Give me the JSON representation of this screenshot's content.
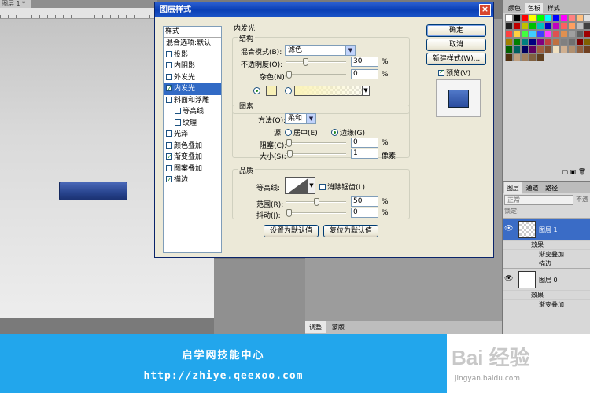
{
  "workspace": {
    "doc_tab": "图层 1 * ×",
    "adjust_tabs": [
      "调整",
      "蒙版"
    ]
  },
  "swatches_panel": {
    "tabs": [
      "颜色",
      "色板",
      "样式"
    ],
    "colors": [
      "#ffffff",
      "#000000",
      "#ff0000",
      "#ffff00",
      "#00ff00",
      "#00ffff",
      "#0000ff",
      "#ff00ff",
      "#ff8080",
      "#ffc080",
      "#e0e0e0",
      "#202020",
      "#c00000",
      "#c0c000",
      "#00c000",
      "#00c0c0",
      "#0000c0",
      "#c000c0",
      "#ff6060",
      "#ffa060",
      "#c0c0c0",
      "#404040",
      "#ff4040",
      "#ffd040",
      "#40ff40",
      "#40d0ff",
      "#4040ff",
      "#ff40ff",
      "#e05050",
      "#e09050",
      "#a0a0a0",
      "#606060",
      "#a00000",
      "#a08000",
      "#008000",
      "#008080",
      "#000080",
      "#800080",
      "#c04040",
      "#c07040",
      "#808080",
      "#707070",
      "#800000",
      "#806000",
      "#006000",
      "#006060",
      "#000060",
      "#600060",
      "#a06040",
      "#805030",
      "#f0e0c0",
      "#d0b090",
      "#b09070",
      "#906040",
      "#704020",
      "#503010",
      "#c0a080",
      "#a08060",
      "#806040",
      "#604020"
    ],
    "tools_label": "▢ ▣ 🗑"
  },
  "layers_panel": {
    "tabs": [
      "图层",
      "通道",
      "路径"
    ],
    "blend_mode": "正常",
    "opacity_label": "不透",
    "lock_label": "锁定:",
    "layers": [
      {
        "name": "图层 1",
        "effects_label": "效果",
        "effects": [
          "渐变叠加",
          "描边"
        ],
        "selected": true
      },
      {
        "name": "图层 0",
        "effects_label": "效果",
        "effects": [
          "渐变叠加"
        ],
        "selected": false
      }
    ]
  },
  "dialog": {
    "title": "图层样式",
    "close": "×",
    "style_list": {
      "header": "样式",
      "items": [
        {
          "label": "混合选项:默认",
          "checkbox": false,
          "checked": false,
          "indent": false,
          "selected": false
        },
        {
          "label": "投影",
          "checkbox": true,
          "checked": false,
          "indent": false,
          "selected": false
        },
        {
          "label": "内阴影",
          "checkbox": true,
          "checked": false,
          "indent": false,
          "selected": false
        },
        {
          "label": "外发光",
          "checkbox": true,
          "checked": false,
          "indent": false,
          "selected": false
        },
        {
          "label": "内发光",
          "checkbox": true,
          "checked": true,
          "indent": false,
          "selected": true
        },
        {
          "label": "斜面和浮雕",
          "checkbox": true,
          "checked": false,
          "indent": false,
          "selected": false
        },
        {
          "label": "等高线",
          "checkbox": true,
          "checked": false,
          "indent": true,
          "selected": false
        },
        {
          "label": "纹理",
          "checkbox": true,
          "checked": false,
          "indent": true,
          "selected": false
        },
        {
          "label": "光泽",
          "checkbox": true,
          "checked": false,
          "indent": false,
          "selected": false
        },
        {
          "label": "颜色叠加",
          "checkbox": true,
          "checked": false,
          "indent": false,
          "selected": false
        },
        {
          "label": "渐变叠加",
          "checkbox": true,
          "checked": true,
          "indent": false,
          "selected": false
        },
        {
          "label": "图案叠加",
          "checkbox": true,
          "checked": false,
          "indent": false,
          "selected": false
        },
        {
          "label": "描边",
          "checkbox": true,
          "checked": true,
          "indent": false,
          "selected": false
        }
      ]
    },
    "section_title": "内发光",
    "structure": {
      "title": "结构",
      "blend_label": "混合模式(B):",
      "blend_value": "滤色",
      "opacity_label": "不透明度(O):",
      "opacity_value": "30",
      "opacity_fraction": 0.3,
      "noise_label": "杂色(N):",
      "noise_value": "0",
      "noise_fraction": 0,
      "unit": "%",
      "glow_color": "#f8f0b6"
    },
    "elements": {
      "title": "图素",
      "method_label": "方法(Q):",
      "method_value": "柔和",
      "source_label": "源:",
      "source_center": "居中(E)",
      "source_edge": "边缘(G)",
      "choke_label": "阻塞(C):",
      "choke_value": "0",
      "choke_fraction": 0,
      "size_label": "大小(S):",
      "size_value": "1",
      "size_fraction": 0.01,
      "percent_unit": "%",
      "pixel_unit": "像素"
    },
    "quality": {
      "title": "品质",
      "contour_label": "等高线:",
      "antialias_label": "消除锯齿(L)",
      "range_label": "范围(R):",
      "range_value": "50",
      "range_fraction": 0.5,
      "jitter_label": "抖动(J):",
      "jitter_value": "0",
      "jitter_fraction": 0,
      "unit": "%"
    },
    "buttons": {
      "make_default": "设置为默认值",
      "reset_default": "复位为默认值",
      "ok": "确定",
      "cancel": "取消",
      "new_style": "新建样式(W)...",
      "preview": "预览(V)"
    }
  },
  "banner": {
    "line1": "启学网技能中心",
    "line2": "http://zhiye.qeexoo.com"
  },
  "watermark": {
    "logo": "Bai 经验",
    "sub": "jingyan.baidu.com"
  }
}
